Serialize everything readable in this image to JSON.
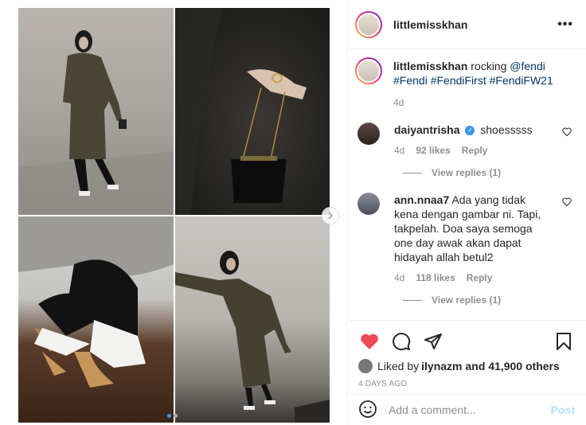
{
  "header": {
    "username": "littlemisskhan",
    "more_label": "•••"
  },
  "caption": {
    "username": "littlemisskhan",
    "text": " rocking ",
    "mention": "@fendi",
    "hashtags": "#Fendi #FendiFirst #FendiFW21",
    "time": "4d"
  },
  "comments": [
    {
      "username": "daiyantrisha",
      "verified": true,
      "text": "shoesssss",
      "time": "4d",
      "likes": "92 likes",
      "reply_label": "Reply",
      "view_replies": "View replies (1)"
    },
    {
      "username": "ann.nnaa7",
      "verified": false,
      "text": "Ada yang tidak kena dengan gambar ni. Tapi, takpelah. Doa saya semoga one day awak akan dapat hidayah allah betul2",
      "time": "4d",
      "likes": "118 likes",
      "reply_label": "Reply",
      "view_replies": "View replies (1)"
    }
  ],
  "likes": {
    "prefix": "Liked by ",
    "user": "ilynazm",
    "suffix": " and 41,900 others"
  },
  "timestamp": "4 DAYS AGO",
  "add_comment": {
    "placeholder": "Add a comment...",
    "post_label": "Post"
  },
  "carousel": {
    "slide_count": 2,
    "current": 1
  },
  "colors": {
    "like_red": "#ed4956",
    "link_blue": "#00376b",
    "verified_blue": "#3897f0"
  }
}
